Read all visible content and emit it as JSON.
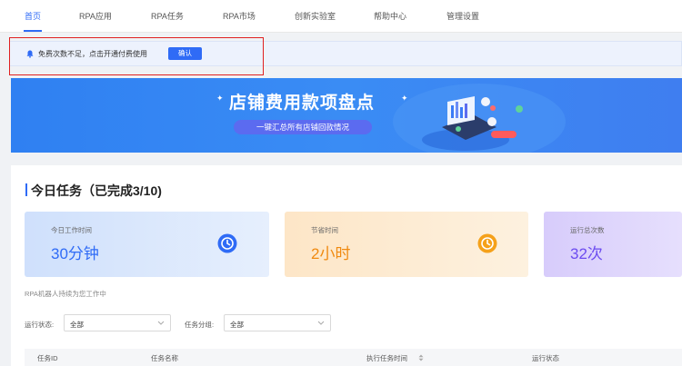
{
  "nav": {
    "items": [
      {
        "label": "首页"
      },
      {
        "label": "RPA应用"
      },
      {
        "label": "RPA任务"
      },
      {
        "label": "RPA市场"
      },
      {
        "label": "创新实验室"
      },
      {
        "label": "帮助中心"
      },
      {
        "label": "管理设置"
      }
    ],
    "active_color": "#2f6bf6"
  },
  "notice": {
    "icon": "bell-icon",
    "text": "免费次数不足，点击开通付费使用",
    "confirm_label": "确认"
  },
  "banner": {
    "title": "店铺费用款项盘点",
    "subtitle": "一键汇总所有店铺回款情况"
  },
  "tasks": {
    "title": "今日任务（已完成3/10)",
    "stats": [
      {
        "label": "今日工作时间",
        "value": "30分钟",
        "icon": "clock-icon",
        "color": "#2f6bf6"
      },
      {
        "label": "节省时间",
        "value": "2小时",
        "icon": "clock-icon",
        "color": "#f08a10"
      },
      {
        "label": "运行总次数",
        "value": "32次",
        "icon": "",
        "color": "#6c4cf0"
      }
    ],
    "robot_text": "RPA机器人持续为您工作中"
  },
  "filters": {
    "status_label": "运行状态:",
    "status_value": "全部",
    "group_label": "任务分组:",
    "group_value": "全部"
  },
  "table": {
    "columns": [
      "任务ID",
      "任务名称",
      "执行任务时间",
      "运行状态"
    ]
  }
}
